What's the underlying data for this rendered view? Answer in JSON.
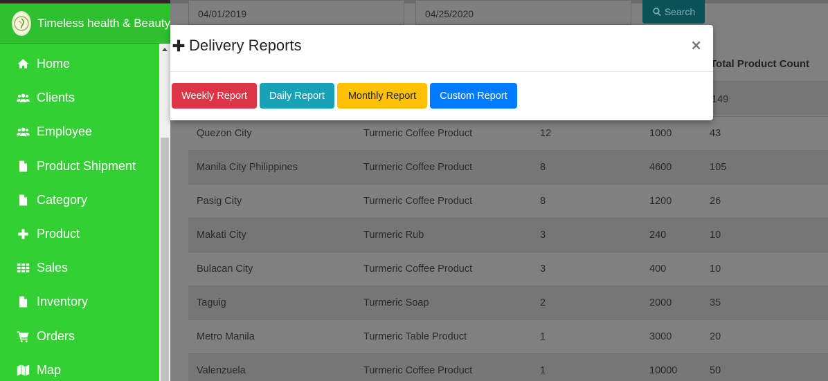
{
  "app": {
    "title": "Timeless health & Beauty"
  },
  "sidebar": {
    "items": [
      {
        "label": "Home",
        "icon": "home-icon"
      },
      {
        "label": "Clients",
        "icon": "users-icon"
      },
      {
        "label": "Employee",
        "icon": "users-icon"
      },
      {
        "label": "Product Shipment",
        "icon": "file-icon"
      },
      {
        "label": "Category",
        "icon": "file-icon"
      },
      {
        "label": "Product",
        "icon": "plus-icon"
      },
      {
        "label": "Sales",
        "icon": "grid-icon"
      },
      {
        "label": "Inventory",
        "icon": "file-icon"
      },
      {
        "label": "Orders",
        "icon": "cart-icon"
      },
      {
        "label": "Map",
        "icon": "map-icon"
      }
    ]
  },
  "filters": {
    "date_from": "04/01/2019",
    "date_to": "04/25/2020",
    "search_label": "Search"
  },
  "table": {
    "header_visible": "Total Product Count",
    "first_row_count_partial": "149",
    "rows": [
      {
        "location": "Quezon City",
        "product": "Turmeric Coffee Product",
        "qty": "12",
        "amount": "1000",
        "count": "43"
      },
      {
        "location": "Manila City Philippines",
        "product": "Turmeric Coffee Product",
        "qty": "8",
        "amount": "4600",
        "count": "105"
      },
      {
        "location": "Pasig City",
        "product": "Turmeric Coffee Product",
        "qty": "8",
        "amount": "1200",
        "count": "26"
      },
      {
        "location": "Makati City",
        "product": "Turmeric Rub",
        "qty": "3",
        "amount": "240",
        "count": "10"
      },
      {
        "location": "Bulacan City",
        "product": "Turmeric Coffee Product",
        "qty": "3",
        "amount": "400",
        "count": "10"
      },
      {
        "location": "Taguig",
        "product": "Turmeric Soap",
        "qty": "2",
        "amount": "2000",
        "count": "35"
      },
      {
        "location": "Metro Manila",
        "product": "Turmeric Table Product",
        "qty": "1",
        "amount": "3000",
        "count": "20"
      },
      {
        "location": "Valenzuela",
        "product": "Turmeric Coffee Product",
        "qty": "1",
        "amount": "10000",
        "count": "50"
      }
    ]
  },
  "modal": {
    "title": "Delivery Reports",
    "close": "×",
    "buttons": {
      "weekly": "Weekly Report",
      "daily": "Daily Report",
      "monthly": "Monthly Report",
      "custom": "Custom Report"
    }
  },
  "colors": {
    "sidebar_green": "#33d033",
    "weekly": "#dc3545",
    "daily": "#17a2b8",
    "monthly": "#ffc107",
    "custom": "#007bff"
  }
}
